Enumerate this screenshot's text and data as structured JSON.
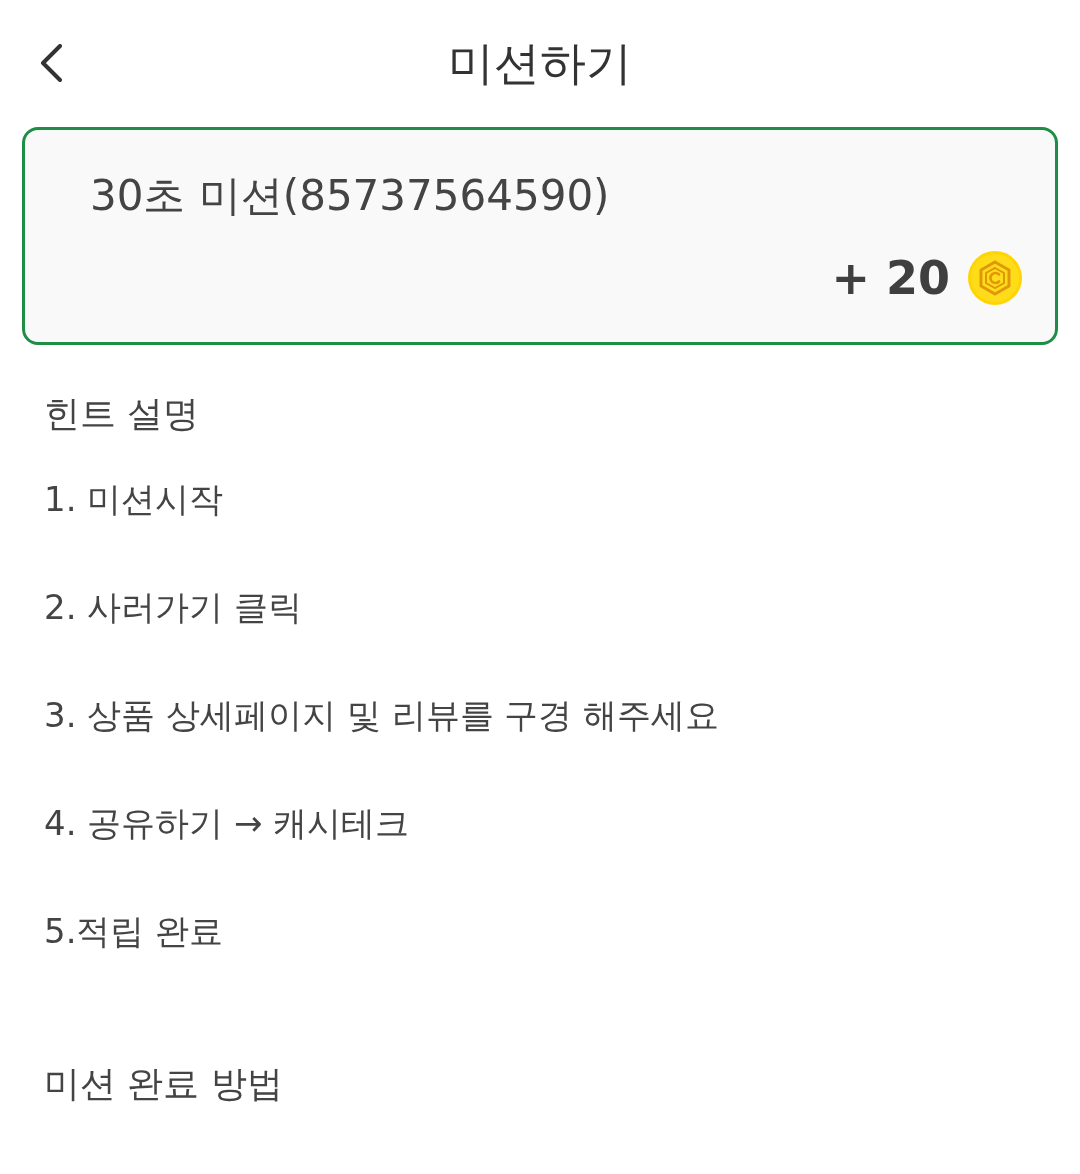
{
  "header": {
    "title": "미션하기"
  },
  "mission_card": {
    "title": "30초 미션(85737564590)",
    "reward": "+ 20"
  },
  "hint_section": {
    "heading": "힌트 설명",
    "steps": [
      "1. 미션시작",
      "2. 사러가기 클릭",
      "3. 상품 상세페이지 및 리뷰를 구경 해주세요",
      "4. 공유하기 → 캐시테크",
      "5.적립 완료"
    ]
  },
  "completion_section": {
    "heading": "미션 완료 방법"
  }
}
